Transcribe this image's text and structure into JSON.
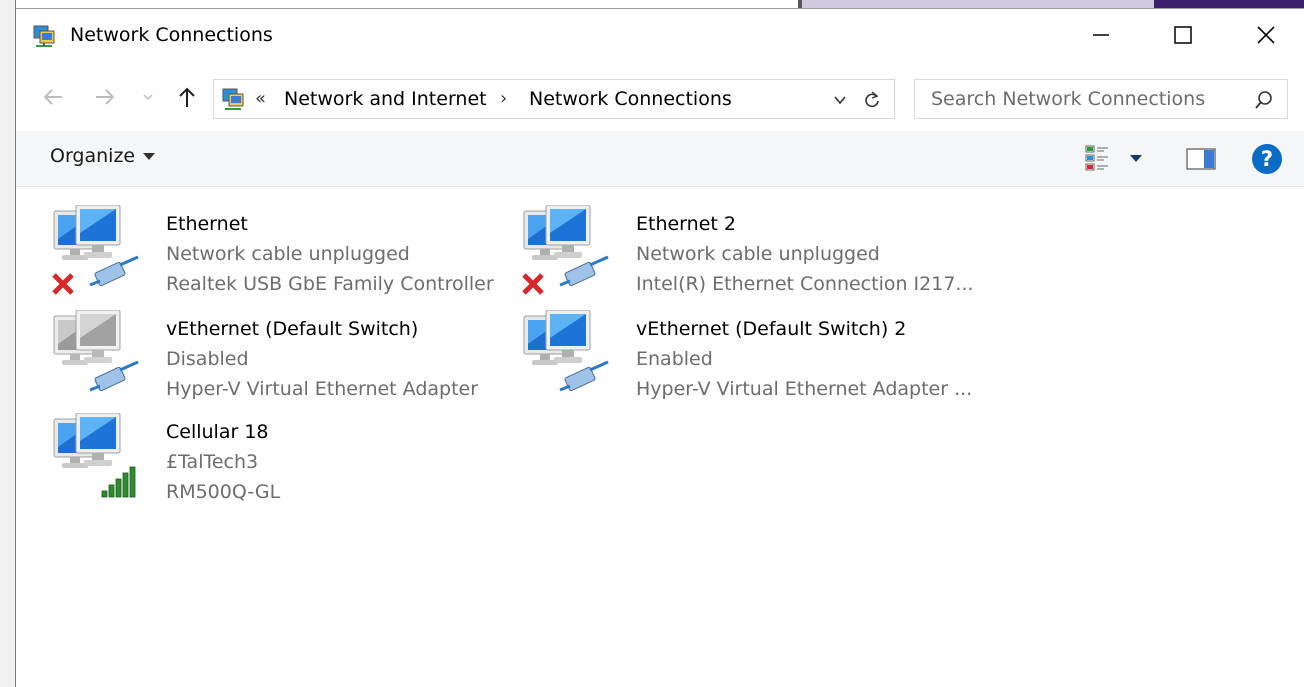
{
  "window": {
    "title": "Network Connections"
  },
  "address": {
    "chevrons": "«",
    "crumbs": [
      "Network and Internet",
      "Network Connections"
    ],
    "separator": "›",
    "search_placeholder": "Search Network Connections"
  },
  "toolbar": {
    "organize_label": "Organize"
  },
  "connections": [
    {
      "name": "Ethernet",
      "status": "Network cable unplugged",
      "device": "Realtek USB GbE Family Controller",
      "state": "unplugged",
      "monitor_color": "blue",
      "badge": "cable"
    },
    {
      "name": "Ethernet 2",
      "status": "Network cable unplugged",
      "device": "Intel(R) Ethernet Connection I217...",
      "state": "unplugged",
      "monitor_color": "blue",
      "badge": "cable"
    },
    {
      "name": "vEthernet (Default Switch)",
      "status": "Disabled",
      "device": "Hyper-V Virtual Ethernet Adapter",
      "state": "disabled",
      "monitor_color": "gray",
      "badge": "cable"
    },
    {
      "name": "vEthernet (Default Switch) 2",
      "status": "Enabled",
      "device": "Hyper-V Virtual Ethernet Adapter ...",
      "state": "enabled",
      "monitor_color": "blue",
      "badge": "cable"
    },
    {
      "name": "Cellular 18",
      "status": "£TalTech3",
      "device": "RM500Q-GL",
      "state": "cellular",
      "monitor_color": "blue",
      "badge": "signal-bars"
    }
  ],
  "colors": {
    "accent": "#0a6cc7",
    "error_x": "#d9262b",
    "signal_green": "#2e8b2e"
  }
}
